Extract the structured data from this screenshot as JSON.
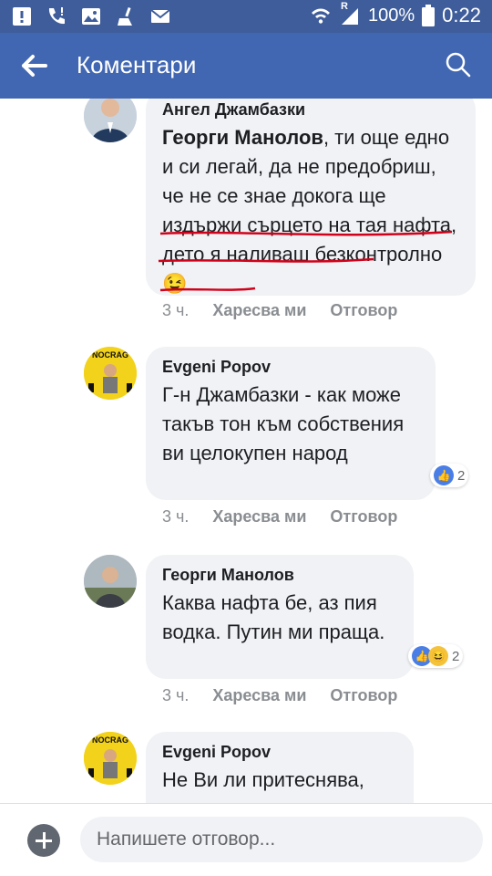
{
  "status_bar": {
    "battery_percent": "100%",
    "time": "0:22",
    "network_label": "R"
  },
  "header": {
    "title": "Коментари"
  },
  "comments": [
    {
      "author": "Ангел Джамбазки",
      "mention": "Георги Манолов",
      "text": ", ти още едно и си легай, да не предобриш, че не се знае докога ще издържи сърцето на тая нафта, дето я наливаш безконтролно",
      "emoji": "😉",
      "time": "3 ч.",
      "like_label": "Харесва ми",
      "reply_label": "Отговор"
    },
    {
      "author": "Evgeni Popov",
      "text": "Г-н Джамбазки - как може такъв тон към собствения ви целокупен народ",
      "time": "3 ч.",
      "like_label": "Харесва ми",
      "reply_label": "Отговор",
      "reaction_count": "2",
      "avatar_text": "NOCRAG"
    },
    {
      "author": "Георги Манолов",
      "text": "Каква нафта бе, аз пия водка. Путин ми праща.",
      "time": "3 ч.",
      "like_label": "Харесва ми",
      "reply_label": "Отговор",
      "reaction_count": "2"
    },
    {
      "author": "Evgeni Popov",
      "text": "Не Ви ли притеснява,",
      "avatar_text": "NOCRAG"
    }
  ],
  "composer": {
    "placeholder": "Напишете отговор..."
  },
  "colors": {
    "status_bar": "#3f5d9a",
    "app_bar": "#4267b2",
    "bubble": "#f0f2f5",
    "underline": "#d0021b",
    "like_blue": "#4a7ee7",
    "haha_yellow": "#f5c33b"
  }
}
